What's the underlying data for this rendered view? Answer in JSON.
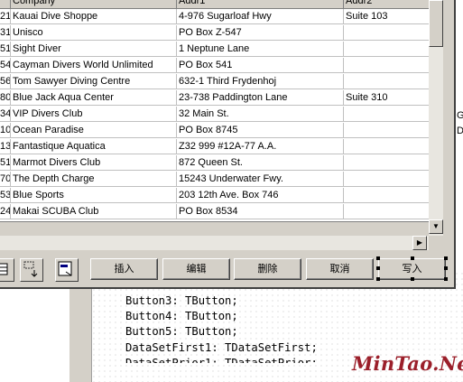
{
  "grid": {
    "columns": [
      "Company",
      "Addr1",
      "Addr2"
    ],
    "rows": [
      {
        "no": "21",
        "company": "Kauai Dive Shoppe",
        "addr1": "4-976 Sugarloaf Hwy",
        "addr2": "Suite 103"
      },
      {
        "no": "31",
        "company": "Unisco",
        "addr1": "PO Box Z-547",
        "addr2": ""
      },
      {
        "no": "51",
        "company": "Sight Diver",
        "addr1": "1 Neptune Lane",
        "addr2": ""
      },
      {
        "no": "54",
        "company": "Cayman Divers World Unlimited",
        "addr1": "PO Box 541",
        "addr2": ""
      },
      {
        "no": "56",
        "company": "Tom Sawyer Diving Centre",
        "addr1": "632-1 Third Frydenhoj",
        "addr2": ""
      },
      {
        "no": "80",
        "company": "Blue Jack Aqua Center",
        "addr1": "23-738 Paddington Lane",
        "addr2": "Suite 310"
      },
      {
        "no": "34",
        "company": "VIP Divers Club",
        "addr1": "32 Main St.",
        "addr2": ""
      },
      {
        "no": "10",
        "company": "Ocean Paradise",
        "addr1": "PO Box 8745",
        "addr2": ""
      },
      {
        "no": "13",
        "company": "Fantastique Aquatica",
        "addr1": "Z32 999 #12A-77 A.A.",
        "addr2": ""
      },
      {
        "no": "51",
        "company": "Marmot Divers Club",
        "addr1": "872 Queen St.",
        "addr2": ""
      },
      {
        "no": "70",
        "company": "The Depth Charge",
        "addr1": "15243 Underwater Fwy.",
        "addr2": ""
      },
      {
        "no": "53",
        "company": "Blue Sports",
        "addr1": "203 12th Ave. Box 746",
        "addr2": ""
      },
      {
        "no": "24",
        "company": "Makai SCUBA Club",
        "addr1": "PO Box 8534",
        "addr2": ""
      }
    ]
  },
  "toolbar": {
    "insert": "插入",
    "edit": "编辑",
    "delete": "删除",
    "cancel": "取消",
    "write": "写入"
  },
  "side_letters": [
    "G",
    "D"
  ],
  "code_lines": [
    "Button3: TButton;",
    "Button4: TButton;",
    "Button5: TButton;",
    "DataSetFirst1: TDataSetFirst;"
  ],
  "watermark": "MinTao.Net"
}
